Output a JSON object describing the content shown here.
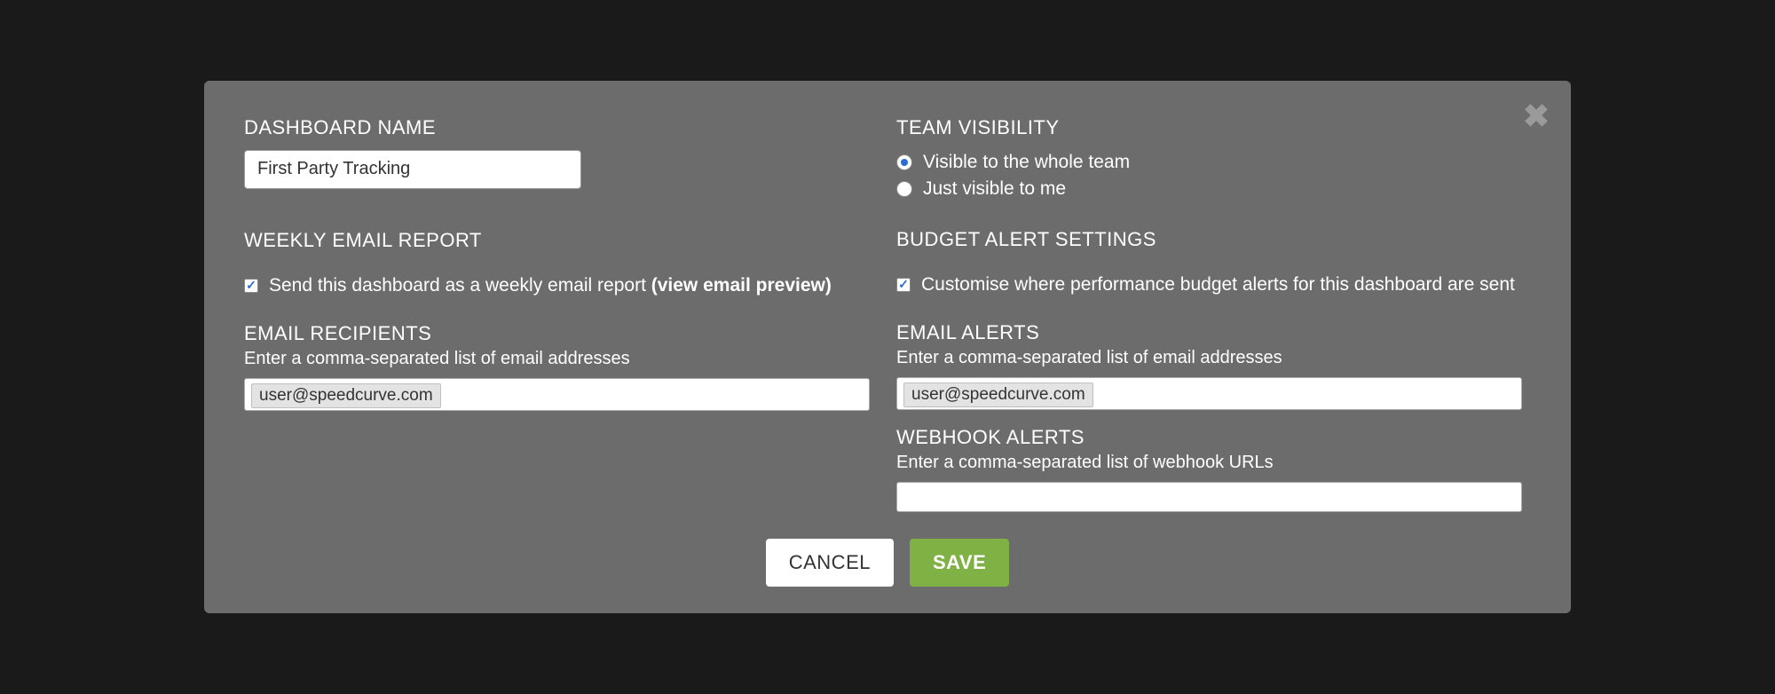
{
  "left": {
    "dashboard_name_label": "DASHBOARD NAME",
    "dashboard_name_value": "First Party Tracking",
    "weekly_report_label": "WEEKLY EMAIL REPORT",
    "weekly_checkbox_checked": true,
    "weekly_checkbox_text": "Send this dashboard as a weekly email report",
    "weekly_preview_link": "(view email preview)",
    "email_recipients_label": "EMAIL RECIPIENTS",
    "email_recipients_help": "Enter a comma-separated list of email addresses",
    "email_recipients_value": "user@speedcurve.com"
  },
  "right": {
    "visibility_label": "TEAM VISIBILITY",
    "visibility_options": {
      "whole_team": "Visible to the whole team",
      "just_me": "Just visible to me"
    },
    "visibility_selected": "whole_team",
    "budget_label": "BUDGET ALERT SETTINGS",
    "budget_checkbox_checked": true,
    "budget_checkbox_text": "Customise where performance budget alerts for this dashboard are sent",
    "email_alerts_label": "EMAIL ALERTS",
    "email_alerts_help": "Enter a comma-separated list of email addresses",
    "email_alerts_value": "user@speedcurve.com",
    "webhook_label": "WEBHOOK ALERTS",
    "webhook_help": "Enter a comma-separated list of webhook URLs",
    "webhook_value": ""
  },
  "actions": {
    "cancel": "CANCEL",
    "save": "SAVE"
  }
}
